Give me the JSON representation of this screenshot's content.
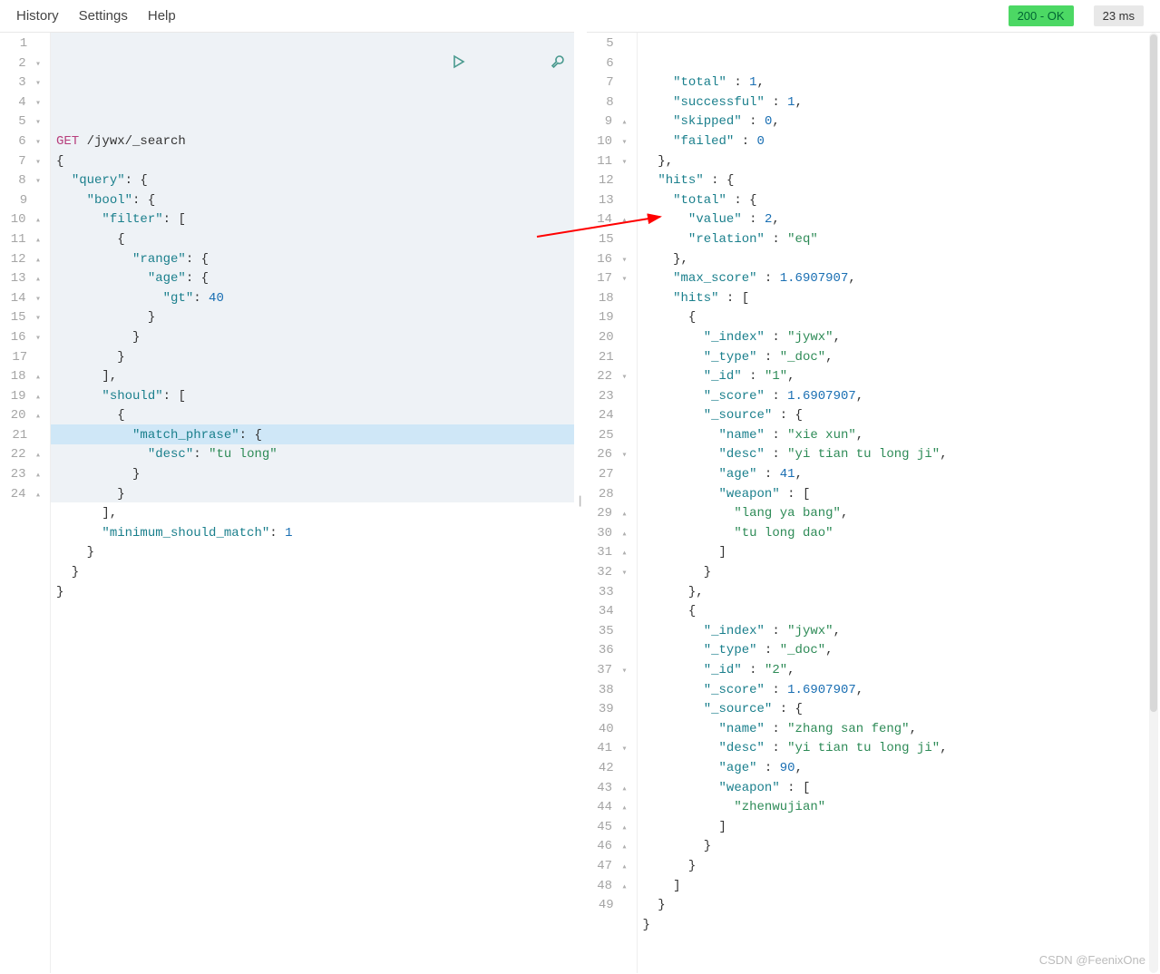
{
  "menubar": {
    "history": "History",
    "settings": "Settings",
    "help": "Help"
  },
  "status": {
    "ok": "200 - OK",
    "time": "23 ms"
  },
  "watermark": "CSDN @FeenixOne",
  "request": {
    "method": "GET",
    "path": "/jywx/_search",
    "body": {
      "query": {
        "bool": {
          "filter": [
            {
              "range": {
                "age": {
                  "gt": 40
                }
              }
            }
          ],
          "should": [
            {
              "match_phrase": {
                "desc": "tu long"
              }
            }
          ],
          "minimum_should_match": 1
        }
      }
    },
    "lines": [
      {
        "n": 1,
        "fold": "",
        "html": "<span class='k-method'>GET</span> /jywx/_search"
      },
      {
        "n": 2,
        "fold": "▾",
        "html": "{"
      },
      {
        "n": 3,
        "fold": "▾",
        "html": "  <span class='k-key'>\"query\"</span>: {"
      },
      {
        "n": 4,
        "fold": "▾",
        "html": "    <span class='k-key'>\"bool\"</span>: {"
      },
      {
        "n": 5,
        "fold": "▾",
        "html": "      <span class='k-key'>\"filter\"</span>: ["
      },
      {
        "n": 6,
        "fold": "▾",
        "html": "        {"
      },
      {
        "n": 7,
        "fold": "▾",
        "html": "          <span class='k-key'>\"range\"</span>: {"
      },
      {
        "n": 8,
        "fold": "▾",
        "html": "            <span class='k-key'>\"age\"</span>: {"
      },
      {
        "n": 9,
        "fold": "",
        "html": "              <span class='k-key'>\"gt\"</span>: <span class='k-num'>40</span>"
      },
      {
        "n": 10,
        "fold": "▴",
        "html": "            }"
      },
      {
        "n": 11,
        "fold": "▴",
        "html": "          }"
      },
      {
        "n": 12,
        "fold": "▴",
        "html": "        }"
      },
      {
        "n": 13,
        "fold": "▴",
        "html": "      ],"
      },
      {
        "n": 14,
        "fold": "▾",
        "html": "      <span class='k-key'>\"should\"</span>: ["
      },
      {
        "n": 15,
        "fold": "▾",
        "html": "        {"
      },
      {
        "n": 16,
        "fold": "▾",
        "html": "          <span class='k-key'>\"match_phrase\"</span>: {"
      },
      {
        "n": 17,
        "fold": "",
        "html": "            <span class='k-key'>\"desc\"</span>: <span class='k-str'>\"tu long\"</span>"
      },
      {
        "n": 18,
        "fold": "▴",
        "html": "          }"
      },
      {
        "n": 19,
        "fold": "▴",
        "html": "        }"
      },
      {
        "n": 20,
        "fold": "▴",
        "html": "      ],"
      },
      {
        "n": 21,
        "fold": "",
        "html": "      <span class='k-key'>\"minimum_should_match\"</span>: <span class='k-num'>1</span>"
      },
      {
        "n": 22,
        "fold": "▴",
        "html": "    }"
      },
      {
        "n": 23,
        "fold": "▴",
        "html": "  }"
      },
      {
        "n": 24,
        "fold": "▴",
        "html": "}"
      }
    ]
  },
  "response": {
    "body": {
      "total": 1,
      "successful": 1,
      "skipped": 0,
      "failed": 0,
      "hits": {
        "total": {
          "value": 2,
          "relation": "eq"
        },
        "max_score": 1.6907907,
        "hits": [
          {
            "_index": "jywx",
            "_type": "_doc",
            "_id": "1",
            "_score": 1.6907907,
            "_source": {
              "name": "xie xun",
              "desc": "yi tian tu long ji",
              "age": 41,
              "weapon": [
                "lang ya bang",
                "tu long dao"
              ]
            }
          },
          {
            "_index": "jywx",
            "_type": "_doc",
            "_id": "2",
            "_score": 1.6907907,
            "_source": {
              "name": "zhang san feng",
              "desc": "yi tian tu long ji",
              "age": 90,
              "weapon": [
                "zhenwujian"
              ]
            }
          }
        ]
      }
    },
    "lines": [
      {
        "n": 5,
        "fold": "",
        "html": "    <span class='k-key'>\"total\"</span> : <span class='k-num'>1</span>,"
      },
      {
        "n": 6,
        "fold": "",
        "html": "    <span class='k-key'>\"successful\"</span> : <span class='k-num'>1</span>,"
      },
      {
        "n": 7,
        "fold": "",
        "html": "    <span class='k-key'>\"skipped\"</span> : <span class='k-num'>0</span>,"
      },
      {
        "n": 8,
        "fold": "",
        "html": "    <span class='k-key'>\"failed\"</span> : <span class='k-num'>0</span>"
      },
      {
        "n": 9,
        "fold": "▴",
        "html": "  },"
      },
      {
        "n": 10,
        "fold": "▾",
        "html": "  <span class='k-key'>\"hits\"</span> : {"
      },
      {
        "n": 11,
        "fold": "▾",
        "html": "    <span class='k-key'>\"total\"</span> : {"
      },
      {
        "n": 12,
        "fold": "",
        "html": "      <span class='k-key'>\"value\"</span> : <span class='k-num'>2</span>,"
      },
      {
        "n": 13,
        "fold": "",
        "html": "      <span class='k-key'>\"relation\"</span> : <span class='k-str'>\"eq\"</span>"
      },
      {
        "n": 14,
        "fold": "▴",
        "html": "    },"
      },
      {
        "n": 15,
        "fold": "",
        "html": "    <span class='k-key'>\"max_score\"</span> : <span class='k-num'>1.6907907</span>,"
      },
      {
        "n": 16,
        "fold": "▾",
        "html": "    <span class='k-key'>\"hits\"</span> : ["
      },
      {
        "n": 17,
        "fold": "▾",
        "html": "      {"
      },
      {
        "n": 18,
        "fold": "",
        "html": "        <span class='k-key'>\"_index\"</span> : <span class='k-str'>\"jywx\"</span>,"
      },
      {
        "n": 19,
        "fold": "",
        "html": "        <span class='k-key'>\"_type\"</span> : <span class='k-str'>\"_doc\"</span>,"
      },
      {
        "n": 20,
        "fold": "",
        "html": "        <span class='k-key'>\"_id\"</span> : <span class='k-str'>\"1\"</span>,"
      },
      {
        "n": 21,
        "fold": "",
        "html": "        <span class='k-key'>\"_score\"</span> : <span class='k-num'>1.6907907</span>,"
      },
      {
        "n": 22,
        "fold": "▾",
        "html": "        <span class='k-key'>\"_source\"</span> : {"
      },
      {
        "n": 23,
        "fold": "",
        "html": "          <span class='k-key'>\"name\"</span> : <span class='k-str'>\"xie xun\"</span>,"
      },
      {
        "n": 24,
        "fold": "",
        "html": "          <span class='k-key'>\"desc\"</span> : <span class='k-str'>\"yi tian tu long ji\"</span>,"
      },
      {
        "n": 25,
        "fold": "",
        "html": "          <span class='k-key'>\"age\"</span> : <span class='k-num'>41</span>,"
      },
      {
        "n": 26,
        "fold": "▾",
        "html": "          <span class='k-key'>\"weapon\"</span> : ["
      },
      {
        "n": 27,
        "fold": "",
        "html": "            <span class='k-str'>\"lang ya bang\"</span>,"
      },
      {
        "n": 28,
        "fold": "",
        "html": "            <span class='k-str'>\"tu long dao\"</span>"
      },
      {
        "n": 29,
        "fold": "▴",
        "html": "          ]"
      },
      {
        "n": 30,
        "fold": "▴",
        "html": "        }"
      },
      {
        "n": 31,
        "fold": "▴",
        "html": "      },"
      },
      {
        "n": 32,
        "fold": "▾",
        "html": "      {"
      },
      {
        "n": 33,
        "fold": "",
        "html": "        <span class='k-key'>\"_index\"</span> : <span class='k-str'>\"jywx\"</span>,"
      },
      {
        "n": 34,
        "fold": "",
        "html": "        <span class='k-key'>\"_type\"</span> : <span class='k-str'>\"_doc\"</span>,"
      },
      {
        "n": 35,
        "fold": "",
        "html": "        <span class='k-key'>\"_id\"</span> : <span class='k-str'>\"2\"</span>,"
      },
      {
        "n": 36,
        "fold": "",
        "html": "        <span class='k-key'>\"_score\"</span> : <span class='k-num'>1.6907907</span>,"
      },
      {
        "n": 37,
        "fold": "▾",
        "html": "        <span class='k-key'>\"_source\"</span> : {"
      },
      {
        "n": 38,
        "fold": "",
        "html": "          <span class='k-key'>\"name\"</span> : <span class='k-str'>\"zhang san feng\"</span>,"
      },
      {
        "n": 39,
        "fold": "",
        "html": "          <span class='k-key'>\"desc\"</span> : <span class='k-str'>\"yi tian tu long ji\"</span>,"
      },
      {
        "n": 40,
        "fold": "",
        "html": "          <span class='k-key'>\"age\"</span> : <span class='k-num'>90</span>,"
      },
      {
        "n": 41,
        "fold": "▾",
        "html": "          <span class='k-key'>\"weapon\"</span> : ["
      },
      {
        "n": 42,
        "fold": "",
        "html": "            <span class='k-str'>\"zhenwujian\"</span>"
      },
      {
        "n": 43,
        "fold": "▴",
        "html": "          ]"
      },
      {
        "n": 44,
        "fold": "▴",
        "html": "        }"
      },
      {
        "n": 45,
        "fold": "▴",
        "html": "      }"
      },
      {
        "n": 46,
        "fold": "▴",
        "html": "    ]"
      },
      {
        "n": 47,
        "fold": "▴",
        "html": "  }"
      },
      {
        "n": 48,
        "fold": "▴",
        "html": "}"
      },
      {
        "n": 49,
        "fold": "",
        "html": ""
      }
    ]
  }
}
